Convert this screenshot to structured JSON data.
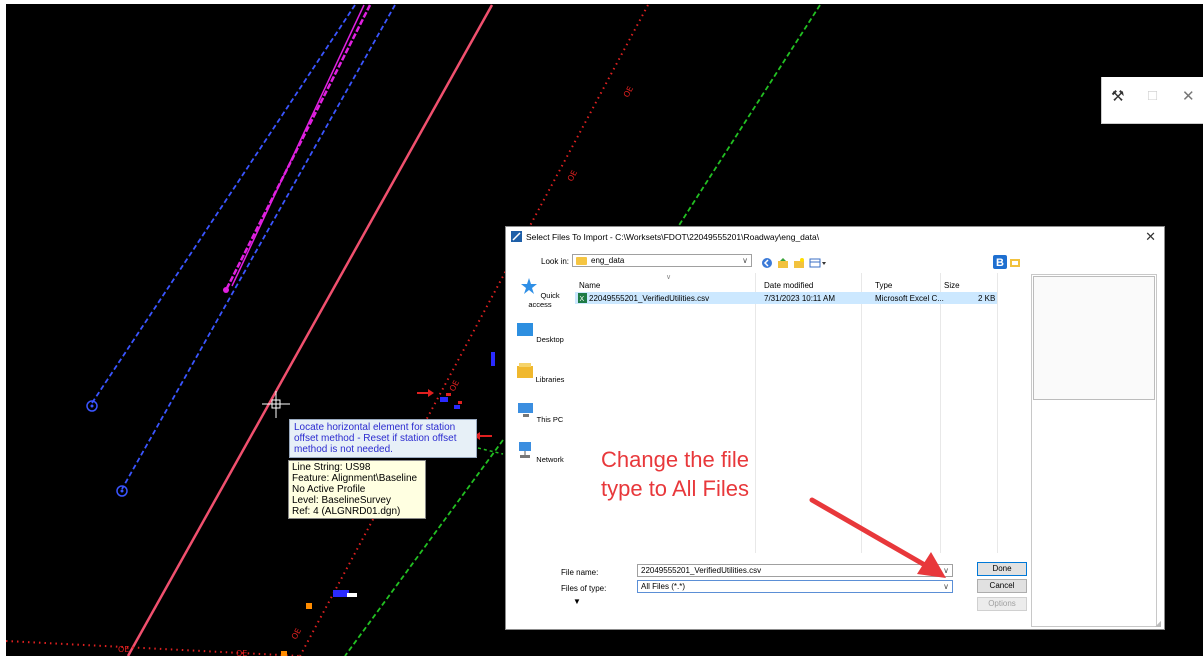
{
  "cad": {
    "locate_prompt": "Locate horizontal element for station offset method - Reset if station offset method is not needed.",
    "info_lines": [
      "Line String: US98",
      "Feature: Alignment\\Baseline",
      "No Active Profile",
      "Level: BaselineSurvey",
      "Ref: 4 (ALGNRD01.dgn)"
    ],
    "line_labels": [
      "OE",
      "OE",
      "OE",
      "OE",
      "OE",
      "OE",
      "OE"
    ]
  },
  "mini_window": {
    "icons": [
      "wrench-icon",
      "maximize-icon",
      "close-icon"
    ]
  },
  "dialog": {
    "title": "Select Files To Import - C:\\Worksets\\FDOT\\22049555201\\Roadway\\eng_data\\",
    "look_in_label": "Look in:",
    "look_in_value": "eng_data",
    "places": [
      "Quick access",
      "Desktop",
      "Libraries",
      "This PC",
      "Network"
    ],
    "columns": [
      "Name",
      "Date modified",
      "Type",
      "Size"
    ],
    "files": [
      {
        "name": "22049555201_VerifiedUtilities.csv",
        "date": "7/31/2023 10:11 AM",
        "type": "Microsoft Excel C...",
        "size": "2 KB"
      }
    ],
    "file_name_label": "File name:",
    "file_name_value": "22049555201_VerifiedUtilities.csv",
    "file_type_label": "Files of type:",
    "file_type_value": "All Files (*.*)",
    "buttons": {
      "done": "Done",
      "cancel": "Cancel",
      "options": "Options"
    }
  },
  "annotation": {
    "text_line1": "Change the file",
    "text_line2": "type to All Files",
    "color": "#e8383b"
  },
  "colors": {
    "cad_background": "#000000",
    "alignment_line": "#f0506e",
    "blue_dashed": "#3a55ff",
    "green_dashed": "#22c022",
    "red_dotted": "#e02020",
    "magenta": "#e020e0"
  }
}
